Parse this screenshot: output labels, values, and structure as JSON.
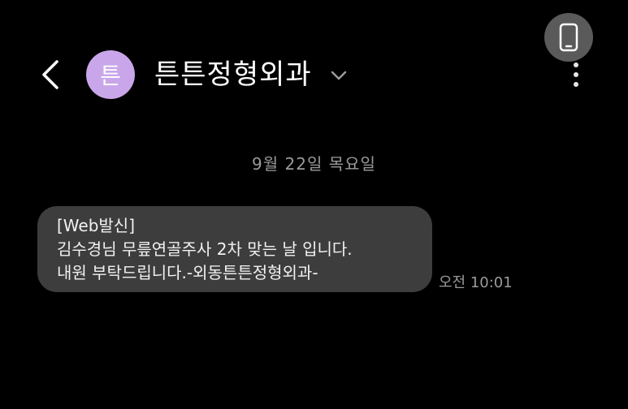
{
  "header": {
    "avatar_letter": "튼",
    "contact_name": "튼튼정형외과",
    "colors": {
      "avatar": "#c9a6ea",
      "call_button": "#5a5a5a",
      "background": "#000000"
    }
  },
  "conversation": {
    "date_label": "9월 22일 목요일",
    "messages": [
      {
        "lines": [
          "[Web발신]",
          "김수경님 무릎연골주사 2차 맞는 날 입니다.",
          "내원 부탁드립니다.-외동튼튼정형외과-"
        ],
        "time": "오전 10:01",
        "bubble_color": "#3d3d3d"
      }
    ]
  },
  "icons": {
    "back": "chevron-left-icon",
    "expand": "chevron-down-icon",
    "call": "phone-icon",
    "more": "more-vertical-icon"
  }
}
